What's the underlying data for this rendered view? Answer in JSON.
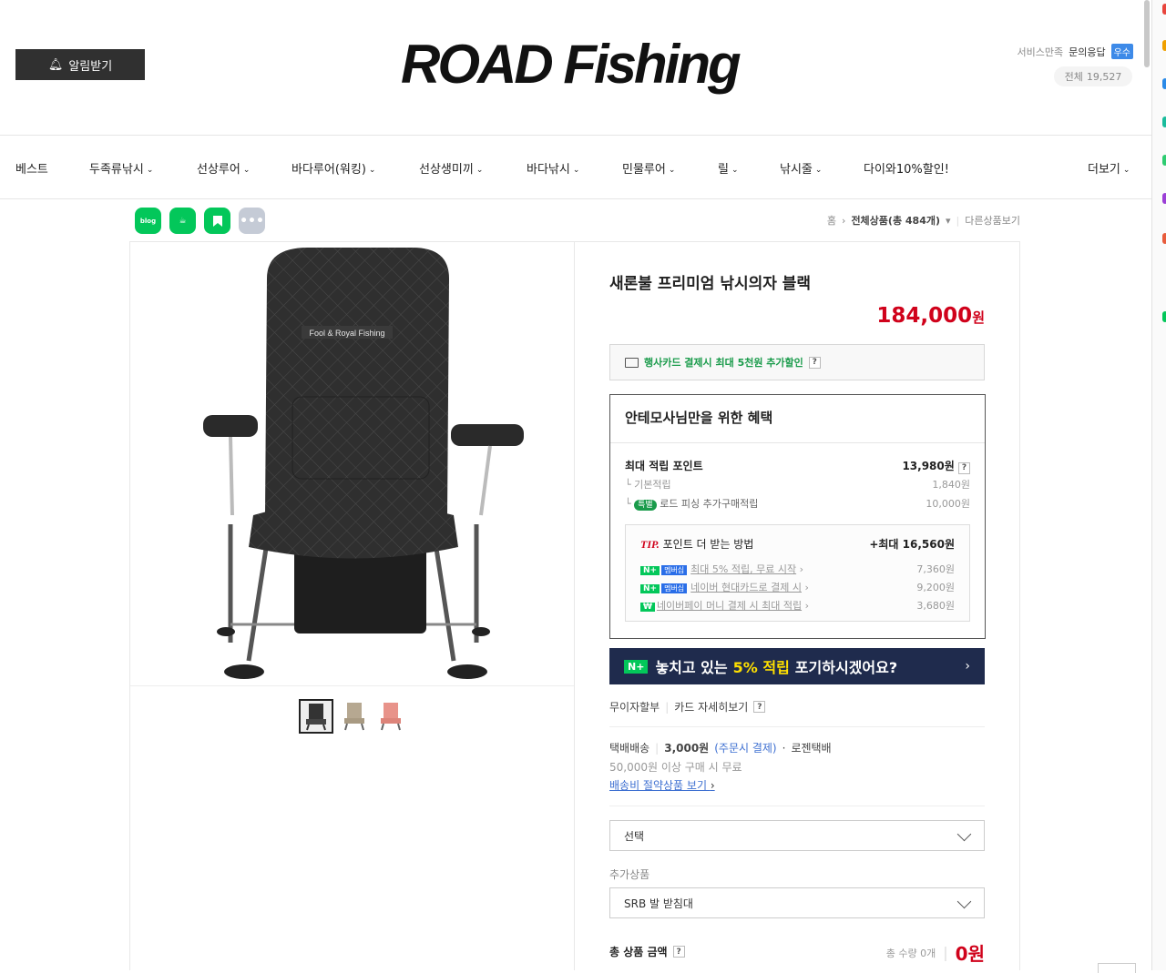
{
  "header": {
    "alarm_button": "알림받기",
    "logo": "ROAD Fishing",
    "satisfaction_label": "서비스만족",
    "inquiry_label": "문의응답",
    "inquiry_badge": "우수",
    "total_label": "전체",
    "total_count": "19,527"
  },
  "nav": {
    "items": [
      "베스트",
      "두족류낚시",
      "선상루어",
      "바다루어(워킹)",
      "선상생미끼",
      "바다낚시",
      "민물루어",
      "릴",
      "낚시줄",
      "다이와10%할인!"
    ],
    "more": "더보기"
  },
  "share": {
    "blog": "blog"
  },
  "breadcrumb": {
    "home": "홈",
    "all_products": "전체상품(총 484개)",
    "other": "다른상품보기"
  },
  "product": {
    "title": "새론불 프리미엄 낚시의자 블랙",
    "price": "184,000",
    "price_unit": "원",
    "card_discount": "행사카드 결제시 최대 5천원 추가할인",
    "benefit": {
      "title": "안테모사님만을 위한 혜택",
      "max_points_label": "최대 적립 포인트",
      "max_points_value": "13,980원",
      "basic_label": "기본적립",
      "basic_value": "1,840원",
      "special_badge": "특별",
      "special_label": "로드 피싱 추가구매적립",
      "special_value": "10,000원",
      "tip_label": "TIP.",
      "tip_title": "포인트 더 받는 방법",
      "tip_max": "+최대 16,560원",
      "tips": [
        {
          "badge": "멤버십",
          "text": "최대 5% 적립, 무료 시작",
          "value": "7,360원"
        },
        {
          "badge": "멤버십",
          "text": "네이버 현대카드로 결제 시",
          "value": "9,200원"
        },
        {
          "badge": "",
          "text": "네이버페이 머니 결제 시 최대 적립",
          "value": "3,680원"
        }
      ]
    },
    "banner": {
      "prefix": "놓치고 있는",
      "highlight": "5% 적립",
      "suffix": "포기하시겠어요?"
    },
    "installment": "무이자할부",
    "card_detail": "카드 자세히보기",
    "shipping": {
      "method": "택배배송",
      "fee": "3,000원",
      "fee_note": "(주문시 결제)",
      "carrier": "로젠택배",
      "free_condition": "50,000원 이상 구매 시 무료",
      "save_link": "배송비 절약상품 보기"
    },
    "option_select": "선택",
    "addon_label": "추가상품",
    "addon_select": "SRB 발 받침대",
    "total_label": "총 상품 금액",
    "total_qty": "총 수량 0개",
    "total_price": "0원"
  },
  "colors": {
    "price": "#d0021b",
    "naver_green": "#03c75a",
    "banner_bg": "#1f2b4d",
    "banner_highlight": "#ffe000"
  }
}
